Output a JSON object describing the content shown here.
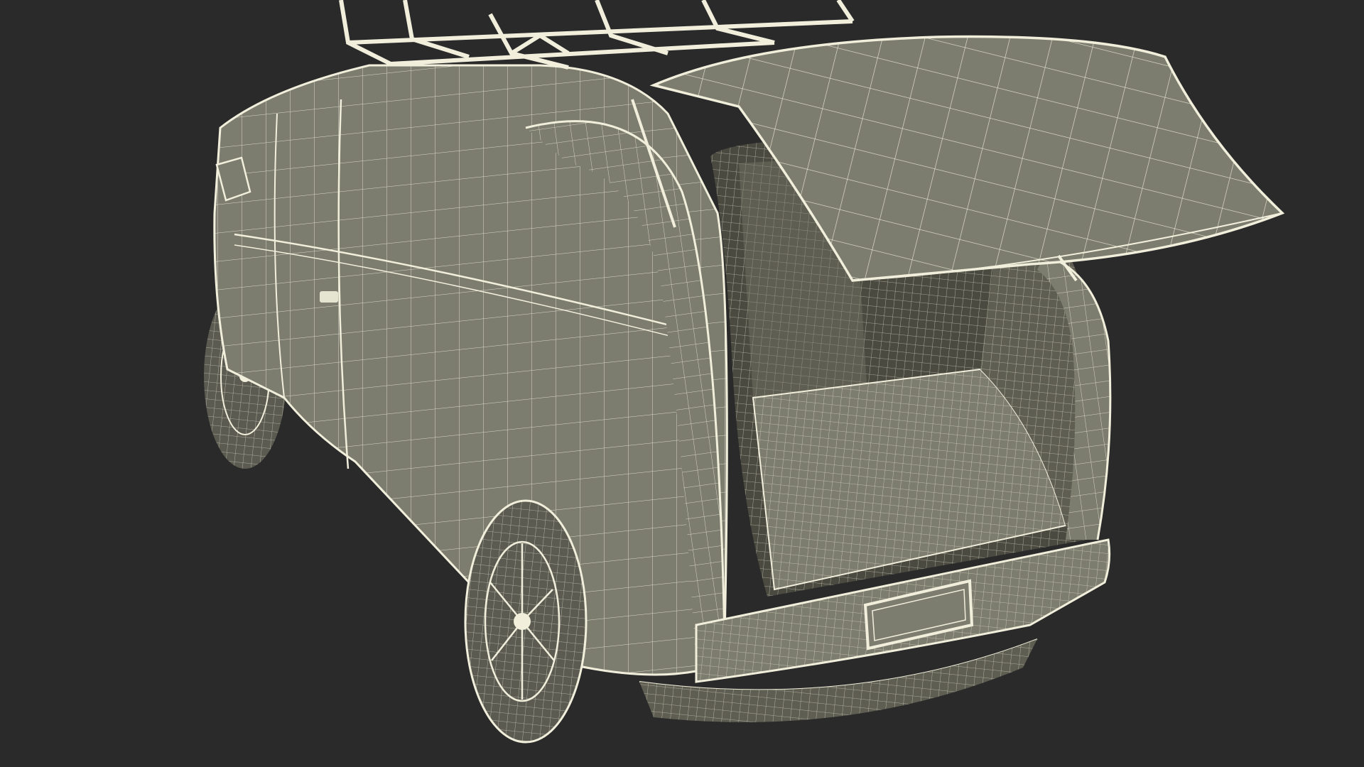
{
  "scene": {
    "subject": "van-wireframe-render",
    "background_color": "#2a2a2a",
    "body_color": "#7d7d6f",
    "body_shadow_color": "#5e5e52",
    "interior_color": "#4a4a40",
    "wire_color": "#f1efdc",
    "tire_color": "#5b5b51"
  }
}
